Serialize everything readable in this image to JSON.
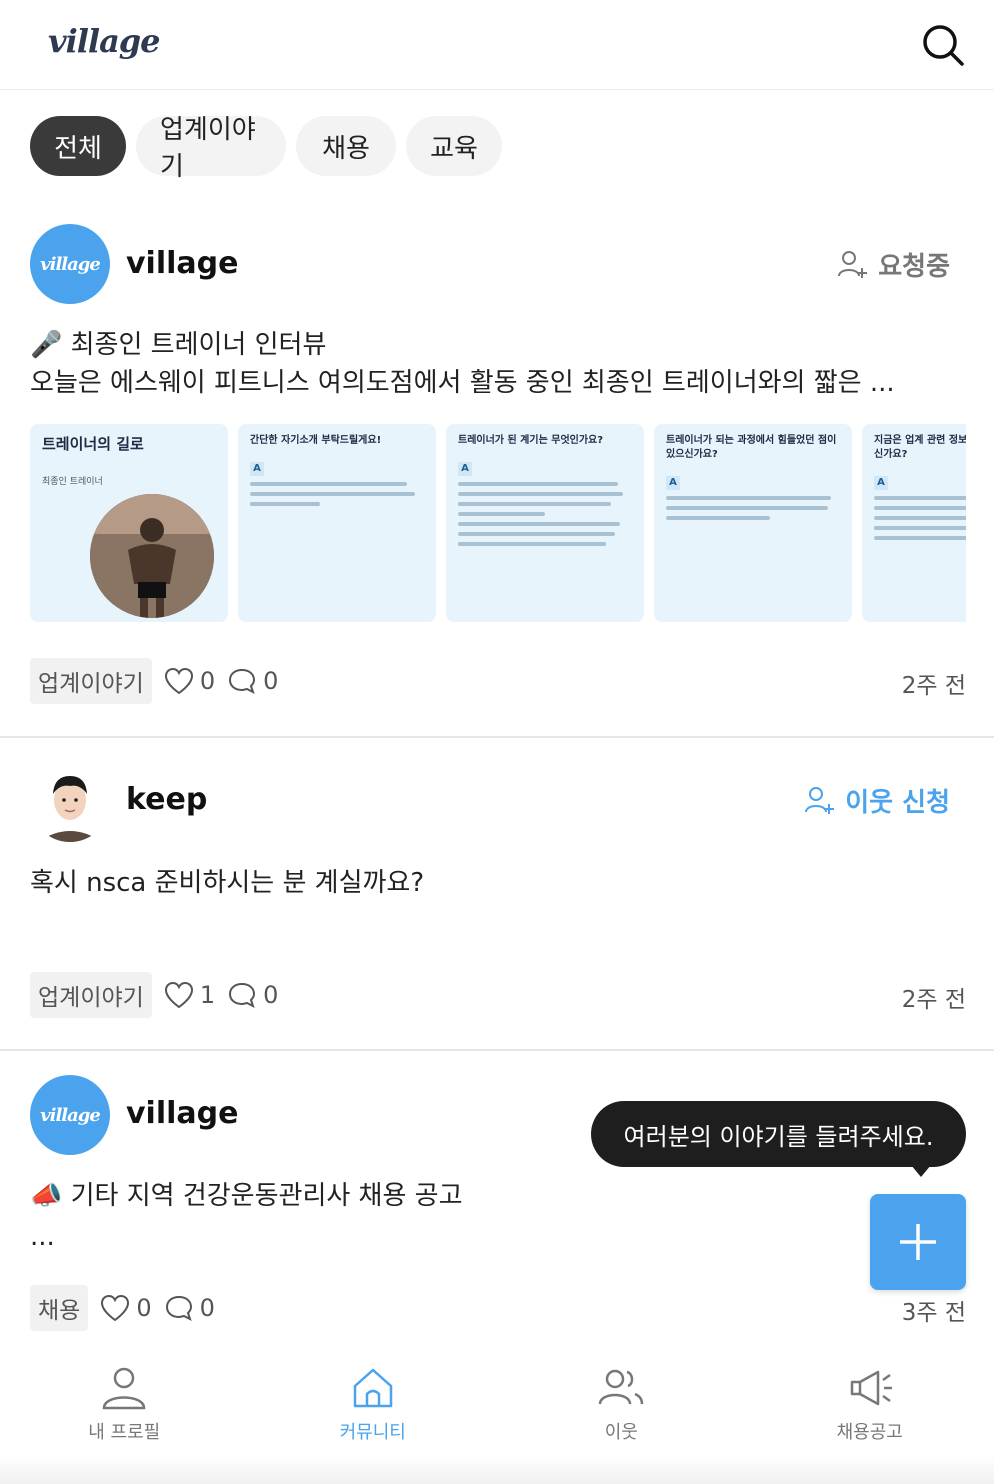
{
  "header": {
    "logo": "village",
    "search_icon": "search-icon"
  },
  "tabs": [
    {
      "label": "전체",
      "active": true
    },
    {
      "label": "업계이야기",
      "active": false
    },
    {
      "label": "채용",
      "active": false
    },
    {
      "label": "교육",
      "active": false
    }
  ],
  "posts": [
    {
      "author": "village",
      "avatar_text": "village",
      "follow_label": "요청중",
      "title": "🎤 최종인 트레이너 인터뷰",
      "body": "오늘은 에스웨이 피트니스 여의도점에서 활동 중인 최종인 트레이너와의 짧은 ...",
      "thumbs": [
        {
          "heading": "트레이너의 길로",
          "subtitle": "최종인 트레이너"
        },
        {
          "question": "간단한 자기소개 부탁드릴게요!",
          "answer_mark": "A"
        },
        {
          "question": "트레이너가 된 계기는 무엇인가요?",
          "answer_mark": "A"
        },
        {
          "question": "트레이너가 되는 과정에서 힘들었던 점이 있으신가요?",
          "answer_mark": "A"
        },
        {
          "question": "지금은 업계 관련 정보를 어떻게 얻고 계신가요?",
          "answer_mark": "A"
        }
      ],
      "category": "업계이야기",
      "likes": "0",
      "comments": "0",
      "time": "2주 전"
    },
    {
      "author": "keep",
      "follow_label": "이웃 신청",
      "body": "혹시 nsca 준비하시는 분 계실까요?",
      "category": "업계이야기",
      "likes": "1",
      "comments": "0",
      "time": "2주 전"
    },
    {
      "author": "village",
      "avatar_text": "village",
      "title": "📣 기타 지역 건강운동관리사 채용 공고",
      "body": "...",
      "category": "채용",
      "likes": "0",
      "comments": "0",
      "time": "3주 전"
    }
  ],
  "tooltip": "여러분의 이야기를 들려주세요.",
  "fab_icon": "plus-icon",
  "bottom_nav": [
    {
      "label": "내 프로필",
      "icon": "profile-icon",
      "active": false
    },
    {
      "label": "커뮤니티",
      "icon": "home-icon",
      "active": true
    },
    {
      "label": "이웃",
      "icon": "people-icon",
      "active": false
    },
    {
      "label": "채용공고",
      "icon": "megaphone-icon",
      "active": false
    }
  ],
  "colors": {
    "accent": "#4aa3ec",
    "dark_tab": "#3a3a3a"
  }
}
